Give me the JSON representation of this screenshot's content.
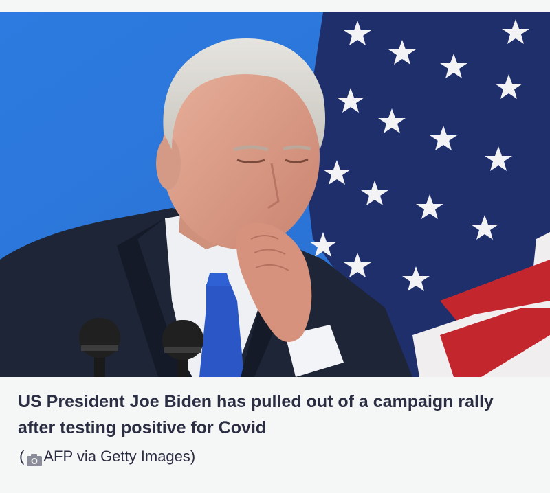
{
  "article": {
    "image_alt": "Joe Biden coughing into his fist at a podium in front of a US flag",
    "caption": "US President Joe Biden has pulled out of a campaign rally after testing positive for Covid",
    "credit": {
      "open": "(",
      "icon": "camera-icon",
      "text": "AFP via Getty Images)"
    }
  },
  "colors": {
    "background": "#f5f6f6",
    "text": "#2b2d42",
    "backdrop_blue": "#2f7fe0",
    "flag_navy": "#1f2f6b",
    "flag_red": "#c4262e"
  }
}
